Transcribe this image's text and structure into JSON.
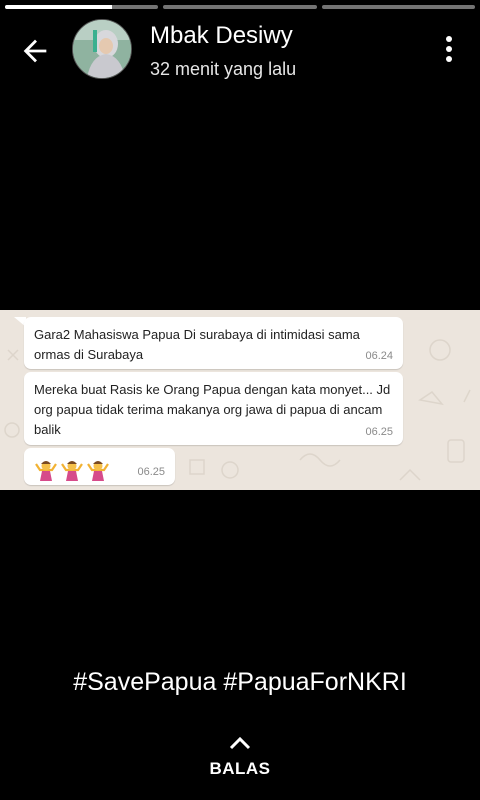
{
  "story": {
    "segments": [
      {
        "progress": 1.0
      },
      {
        "progress": 0.0
      },
      {
        "progress": 0.0
      }
    ],
    "segments_filled_first_partial": 0.7
  },
  "header": {
    "name": "Mbak Desiwy",
    "time": "32 menit yang lalu",
    "back_icon": "arrow-left-icon",
    "menu_icon": "more-vert-icon"
  },
  "messages": [
    {
      "text": "Gara2 Mahasiswa Papua Di surabaya di intimidasi sama ormas di Surabaya",
      "time": "06.24"
    },
    {
      "text": "Mereka buat Rasis ke Orang Papua dengan kata monyet... Jd org papua tidak terima makanya org jawa di papua di ancam balik",
      "time": "06.25"
    },
    {
      "text": "",
      "time": "06.25",
      "emoji": [
        "person-shrugging",
        "person-shrugging",
        "person-shrugging"
      ]
    }
  ],
  "caption": "#SavePapua #PapuaForNKRI",
  "reply": {
    "label": "BALAS",
    "icon": "chevron-up-icon"
  },
  "colors": {
    "chat_background": "#ece5dd",
    "bubble": "#ffffff"
  }
}
